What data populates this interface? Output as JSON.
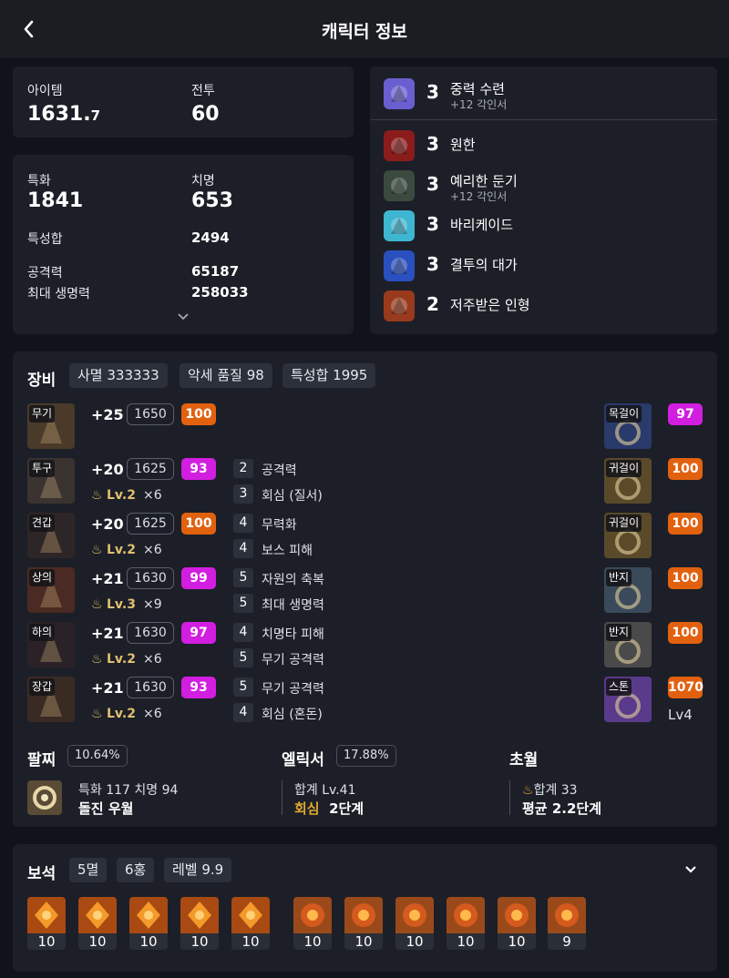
{
  "header": {
    "title": "캐릭터 정보",
    "back_icon": "chevron-left-icon"
  },
  "stats_top": {
    "item_label": "아이템",
    "item_value_main": "1631.",
    "item_value_dec": "7",
    "combat_label": "전투",
    "combat_value": "60"
  },
  "stats_detail": {
    "spec_label": "특화",
    "spec_value": "1841",
    "crit_label": "치명",
    "crit_value": "653",
    "trait_sum_label": "특성합",
    "trait_sum_value": "2494",
    "attack_label": "공격력",
    "attack_value": "65187",
    "maxhp_label": "최대 생명력",
    "maxhp_value": "258033"
  },
  "engravings": [
    {
      "level": "3",
      "name": "중력 수련",
      "sub": "+12 각인서",
      "icon": "gravity-engraving-icon",
      "color": "#6a5fd1"
    },
    {
      "level": "3",
      "name": "원한",
      "sub": "",
      "icon": "grudge-engraving-icon",
      "color": "#8b1c1c"
    },
    {
      "level": "3",
      "name": "예리한 둔기",
      "sub": "+12 각인서",
      "icon": "keen-blunt-engraving-icon",
      "color": "#3a4a3e"
    },
    {
      "level": "3",
      "name": "바리케이드",
      "sub": "",
      "icon": "barricade-engraving-icon",
      "color": "#3fb6d1"
    },
    {
      "level": "3",
      "name": "결투의 대가",
      "sub": "",
      "icon": "master-brawler-engraving-icon",
      "color": "#2a4fbf"
    },
    {
      "level": "2",
      "name": "저주받은 인형",
      "sub": "",
      "icon": "cursed-doll-engraving-icon",
      "color": "#9a3a1c"
    }
  ],
  "equipment": {
    "title": "장비",
    "chips": [
      "사멸 333333",
      "악세 품질 98",
      "특성합 1995"
    ],
    "armor": [
      {
        "tag": "무기",
        "refine": "+25",
        "ilvl": "1650",
        "quality": "100",
        "qcolor": "orange",
        "ench_lv": "",
        "ench_mult": "",
        "effects": []
      },
      {
        "tag": "투구",
        "refine": "+20",
        "ilvl": "1625",
        "quality": "93",
        "qcolor": "pink",
        "ench_lv": "Lv.2",
        "ench_mult": "×6",
        "effects": [
          [
            "2",
            "공격력"
          ],
          [
            "3",
            "회심 (질서)"
          ]
        ]
      },
      {
        "tag": "견갑",
        "refine": "+20",
        "ilvl": "1625",
        "quality": "100",
        "qcolor": "orange",
        "ench_lv": "Lv.2",
        "ench_mult": "×6",
        "effects": [
          [
            "4",
            "무력화"
          ],
          [
            "4",
            "보스 피해"
          ]
        ]
      },
      {
        "tag": "상의",
        "refine": "+21",
        "ilvl": "1630",
        "quality": "99",
        "qcolor": "pink",
        "ench_lv": "Lv.3",
        "ench_mult": "×9",
        "effects": [
          [
            "5",
            "자원의 축복"
          ],
          [
            "5",
            "최대 생명력"
          ]
        ]
      },
      {
        "tag": "하의",
        "refine": "+21",
        "ilvl": "1630",
        "quality": "97",
        "qcolor": "pink",
        "ench_lv": "Lv.2",
        "ench_mult": "×6",
        "effects": [
          [
            "4",
            "치명타 피해"
          ],
          [
            "5",
            "무기 공격력"
          ]
        ]
      },
      {
        "tag": "장갑",
        "refine": "+21",
        "ilvl": "1630",
        "quality": "93",
        "qcolor": "pink",
        "ench_lv": "Lv.2",
        "ench_mult": "×6",
        "effects": [
          [
            "5",
            "무기 공격력"
          ],
          [
            "4",
            "회심 (혼돈)"
          ]
        ]
      }
    ],
    "accessories": [
      {
        "tag": "목걸이",
        "quality": "97",
        "qcolor": "pink"
      },
      {
        "tag": "귀걸이",
        "quality": "100",
        "qcolor": "orange"
      },
      {
        "tag": "귀걸이",
        "quality": "100",
        "qcolor": "orange"
      },
      {
        "tag": "반지",
        "quality": "100",
        "qcolor": "orange"
      },
      {
        "tag": "반지",
        "quality": "100",
        "qcolor": "orange"
      },
      {
        "tag": "스톤",
        "quality": "1070",
        "qcolor": "orange",
        "extra": "Lv4"
      }
    ],
    "bracelet": {
      "label": "팔찌",
      "pct": "10.64%",
      "line1": "특화 117  치명 94",
      "line2": "돌진  우월"
    },
    "elixir": {
      "label": "엘릭서",
      "pct": "17.88%",
      "line1": "합계 Lv.41",
      "line2_a": "회심",
      "line2_b": "2단계"
    },
    "transcend": {
      "label": "초월",
      "line1": "합계 33",
      "line2": "평균 2.2단계"
    }
  },
  "gems": {
    "title": "보석",
    "chips": [
      "5멸",
      "6홍",
      "레벨 9.9"
    ],
    "items": [
      "10",
      "10",
      "10",
      "10",
      "10",
      "10",
      "10",
      "10",
      "10",
      "10",
      "9"
    ]
  }
}
